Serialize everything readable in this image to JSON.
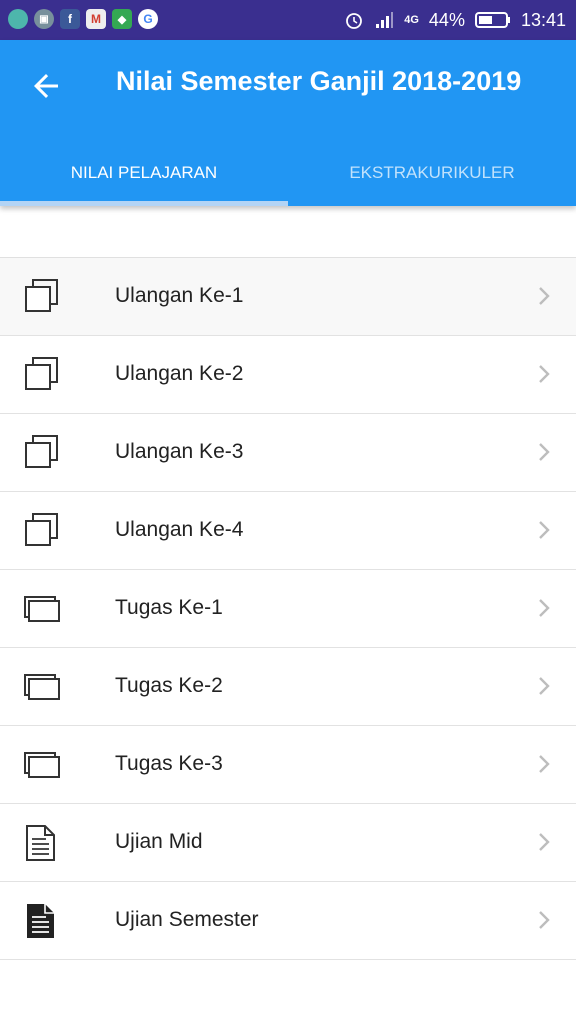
{
  "status_bar": {
    "battery": "44%",
    "time": "13:41",
    "network": "4G",
    "notification_icons": [
      "circle-app-icon",
      "image-icon",
      "facebook-icon",
      "gmail-icon",
      "maps-icon",
      "google-icon"
    ]
  },
  "app_bar": {
    "title": "Nilai Semester Ganjil 2018-2019",
    "color": "#2196f3"
  },
  "tabs": [
    {
      "label": "NILAI PELAJARAN",
      "selected": true
    },
    {
      "label": "EKSTRAKURIKULER",
      "selected": false
    }
  ],
  "items": [
    {
      "label": "Ulangan Ke-1",
      "icon": "copy-icon"
    },
    {
      "label": "Ulangan Ke-2",
      "icon": "copy-icon"
    },
    {
      "label": "Ulangan Ke-3",
      "icon": "copy-icon"
    },
    {
      "label": "Ulangan Ke-4",
      "icon": "copy-icon"
    },
    {
      "label": "Tugas Ke-1",
      "icon": "stacked-pages-icon"
    },
    {
      "label": "Tugas Ke-2",
      "icon": "stacked-pages-icon"
    },
    {
      "label": "Tugas Ke-3",
      "icon": "stacked-pages-icon"
    },
    {
      "label": "Ujian Mid",
      "icon": "document-outline-icon"
    },
    {
      "label": "Ujian Semester",
      "icon": "document-filled-icon"
    }
  ]
}
